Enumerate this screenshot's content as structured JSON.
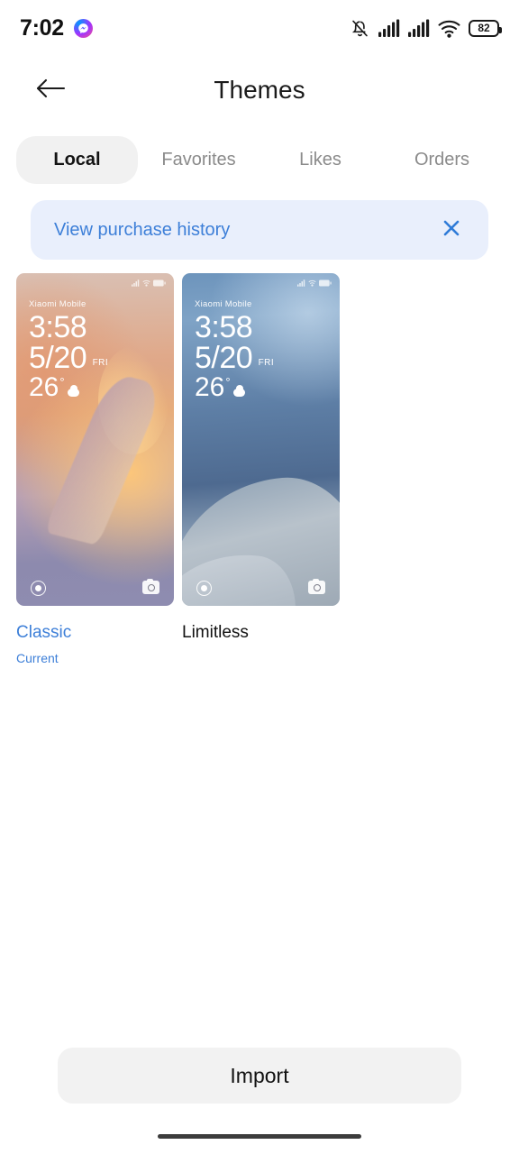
{
  "status_bar": {
    "time": "7:02",
    "messenger_icon": "messenger-icon",
    "silent_icon": "bell-muted-icon",
    "signal_icon_1": "signal-bars-icon",
    "signal_icon_2": "signal-bars-icon",
    "wifi_icon": "wifi-icon",
    "battery_level": "82"
  },
  "header": {
    "back_icon": "back-arrow-icon",
    "title": "Themes"
  },
  "tabs": [
    {
      "label": "Local",
      "active": true
    },
    {
      "label": "Favorites",
      "active": false
    },
    {
      "label": "Likes",
      "active": false
    },
    {
      "label": "Orders",
      "active": false
    }
  ],
  "banner": {
    "text": "View purchase history",
    "close_icon": "close-x-icon",
    "bg_color": "#e9effc",
    "text_color": "#3d7fd8"
  },
  "themes": [
    {
      "name": "Classic",
      "status_label": "Current",
      "is_current": true,
      "preview": {
        "carrier": "Xiaomi Mobile",
        "time": "3:58",
        "date": "5/20",
        "day_of_week": "FRI",
        "temperature": "26",
        "degree": "°",
        "weather_icon": "cloud-icon",
        "left_icon": "flashlight-icon",
        "right_icon": "camera-icon"
      }
    },
    {
      "name": "Limitless",
      "status_label": "",
      "is_current": false,
      "preview": {
        "carrier": "Xiaomi Mobile",
        "time": "3:58",
        "date": "5/20",
        "day_of_week": "FRI",
        "temperature": "26",
        "degree": "°",
        "weather_icon": "cloud-icon",
        "left_icon": "flashlight-icon",
        "right_icon": "camera-icon"
      }
    }
  ],
  "footer": {
    "import_label": "Import"
  }
}
